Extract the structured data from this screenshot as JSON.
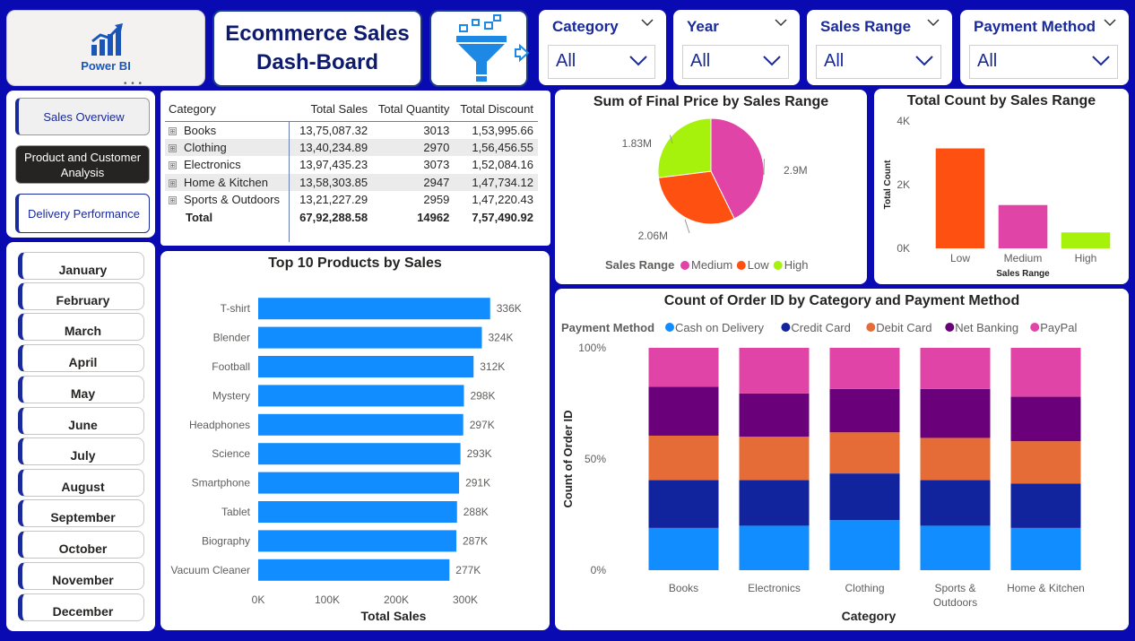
{
  "header": {
    "logo_text": "Power BI",
    "logo_dots": "• • •",
    "title": "Ecommerce Sales\nDash-Board"
  },
  "filters": [
    {
      "label": "Category",
      "value": "All"
    },
    {
      "label": "Year",
      "value": "All"
    },
    {
      "label": "Sales Range",
      "value": "All"
    },
    {
      "label": "Payment Method",
      "value": "All"
    }
  ],
  "nav": {
    "sales_overview": "Sales Overview",
    "product_customer": "Product and Customer Analysis",
    "delivery": "Delivery Performance"
  },
  "months": [
    "January",
    "February",
    "March",
    "April",
    "May",
    "June",
    "July",
    "August",
    "September",
    "October",
    "November",
    "December"
  ],
  "table": {
    "headers": [
      "Category",
      "Total Sales",
      "Total Quantity",
      "Total Discount"
    ],
    "rows": [
      [
        "Books",
        "13,75,087.32",
        "3013",
        "1,53,995.66"
      ],
      [
        "Clothing",
        "13,40,234.89",
        "2970",
        "1,56,456.55"
      ],
      [
        "Electronics",
        "13,97,435.23",
        "3073",
        "1,52,084.16"
      ],
      [
        "Home & Kitchen",
        "13,58,303.85",
        "2947",
        "1,47,734.12"
      ],
      [
        "Sports & Outdoors",
        "13,21,227.29",
        "2959",
        "1,47,220.43"
      ]
    ],
    "total": [
      "Total",
      "67,92,288.58",
      "14962",
      "7,57,490.92"
    ],
    "expand_icon": "⊞"
  },
  "colors": {
    "bar_blue": "#118dff",
    "medium": "#e044a7",
    "low": "#fe5010",
    "high": "#a6f20c",
    "cash": "#118dff",
    "credit": "#12239e",
    "debit": "#e66c37",
    "netbanking": "#6b007b",
    "paypal": "#e044a7"
  },
  "chart_data": [
    {
      "id": "pie",
      "type": "pie",
      "title": "Sum of Final Price by Sales Range",
      "legend_title": "Sales Range",
      "categories": [
        "Medium",
        "Low",
        "High"
      ],
      "values": [
        2.9,
        2.06,
        1.83
      ],
      "labels": [
        "2.9M",
        "2.06M",
        "1.83M"
      ],
      "legend_position": "bottom"
    },
    {
      "id": "count",
      "type": "bar",
      "title": "Total Count by Sales Range",
      "xlabel": "Sales Range",
      "ylabel": "Total Count",
      "categories": [
        "Low",
        "Medium",
        "High"
      ],
      "values": [
        3140,
        1360,
        500
      ],
      "ylim": [
        0,
        4000
      ],
      "yticks": [
        "0K",
        "2K",
        "4K"
      ]
    },
    {
      "id": "top10",
      "type": "bar",
      "orientation": "horizontal",
      "title": "Top 10 Products by Sales",
      "xlabel": "Total Sales",
      "categories": [
        "T-shirt",
        "Blender",
        "Football",
        "Mystery",
        "Headphones",
        "Science",
        "Smartphone",
        "Tablet",
        "Biography",
        "Vacuum Cleaner"
      ],
      "values": [
        336000,
        324000,
        312000,
        298000,
        297000,
        293000,
        291000,
        288000,
        287000,
        277000
      ],
      "labels": [
        "336K",
        "324K",
        "312K",
        "298K",
        "297K",
        "293K",
        "291K",
        "288K",
        "287K",
        "277K"
      ],
      "xlim": [
        0,
        340000
      ],
      "xticks": [
        "0K",
        "100K",
        "200K",
        "300K"
      ]
    },
    {
      "id": "stacked",
      "type": "bar",
      "stacked": "100%",
      "title": "Count of Order ID by Category and Payment Method",
      "xlabel": "Category",
      "ylabel": "Count of Order ID",
      "legend_title": "Payment Method",
      "legend_position": "top-left",
      "categories": [
        "Books",
        "Electronics",
        "Clothing",
        "Sports & Outdoors",
        "Home & Kitchen"
      ],
      "series": [
        {
          "name": "Cash on Delivery",
          "values": [
            19,
            20,
            22.5,
            20,
            19
          ]
        },
        {
          "name": "Credit Card",
          "values": [
            21.5,
            20.5,
            21,
            20.5,
            20
          ]
        },
        {
          "name": "Debit Card",
          "values": [
            20,
            19.5,
            18.5,
            19,
            19
          ]
        },
        {
          "name": "Net Banking",
          "values": [
            22,
            19.5,
            19.5,
            22,
            20
          ]
        },
        {
          "name": "PayPal",
          "values": [
            17.5,
            20.5,
            18.5,
            18.5,
            22
          ]
        }
      ],
      "ylim": [
        0,
        100
      ],
      "yticks": [
        "0%",
        "50%",
        "100%"
      ]
    }
  ]
}
